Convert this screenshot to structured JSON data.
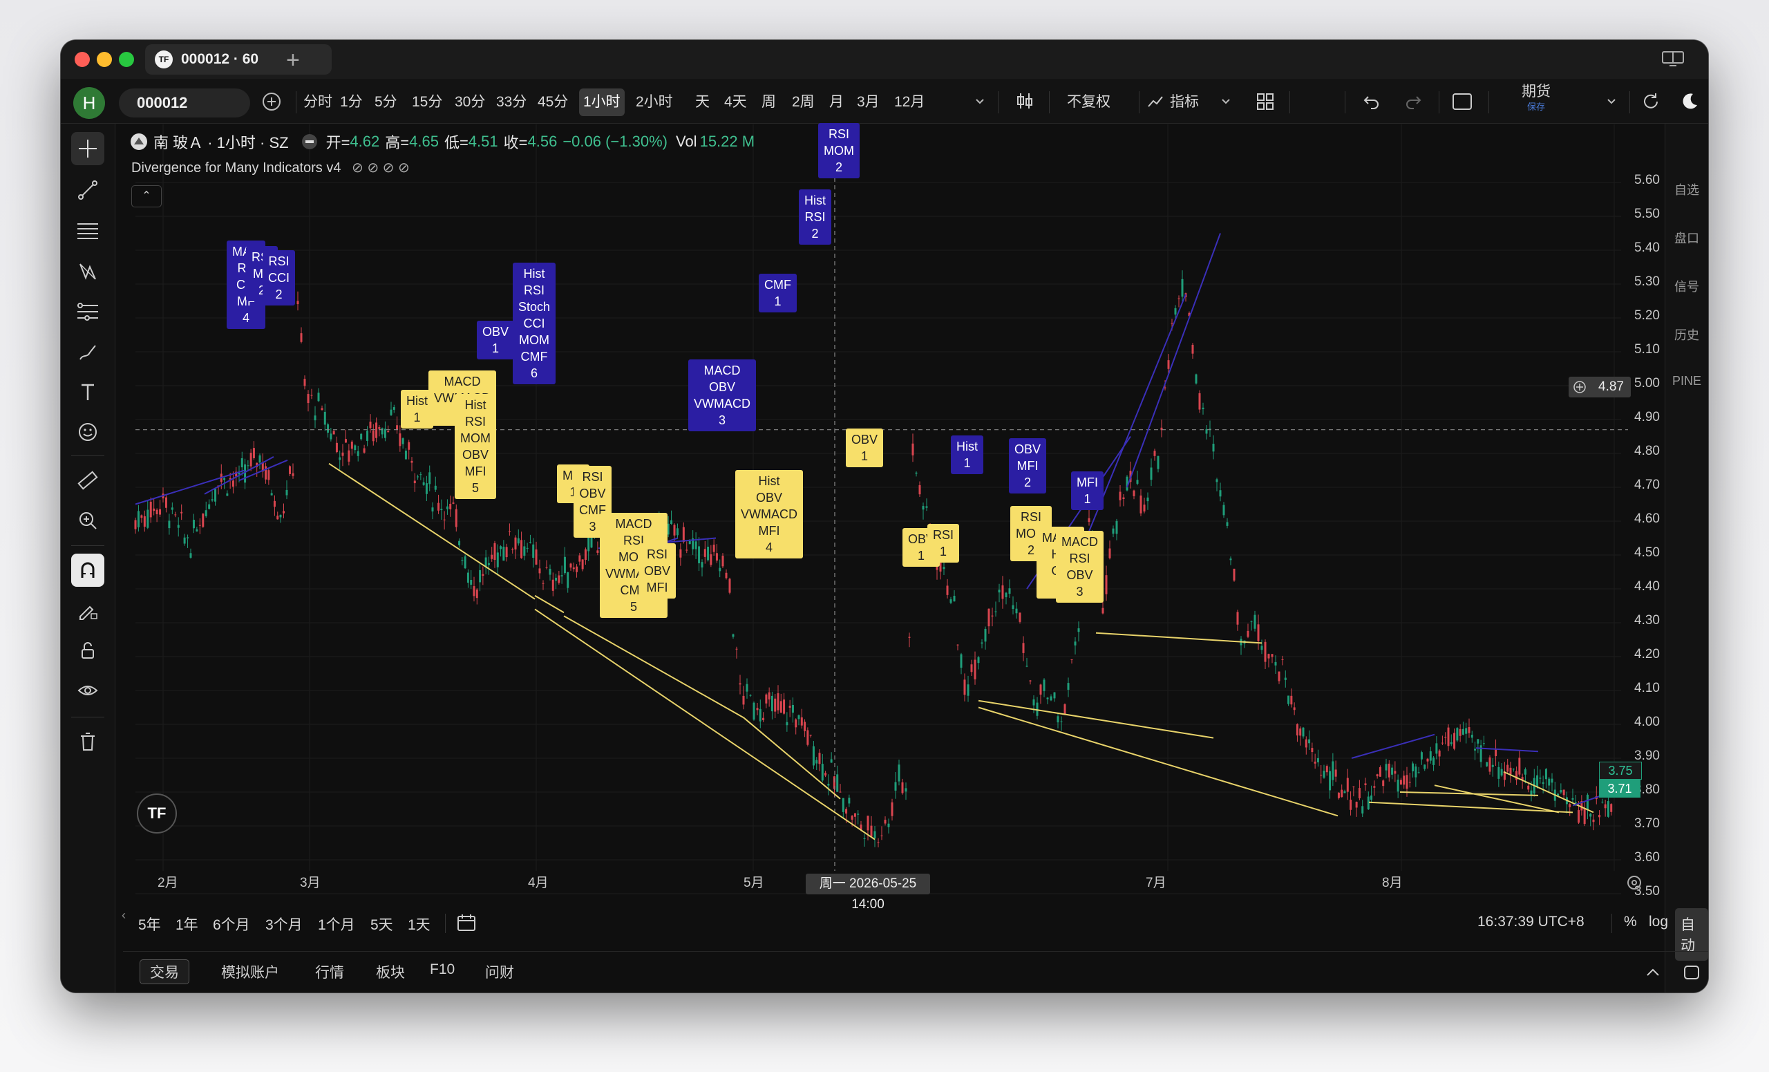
{
  "window": {
    "tab_title": "000012 · 60",
    "tab_logo": "TF"
  },
  "toolbar": {
    "avatar_letter": "H",
    "symbol": "000012",
    "timeframes": [
      "分时",
      "1分",
      "5分",
      "15分",
      "30分",
      "33分",
      "45分",
      "1小时",
      "2小时",
      "天",
      "4天",
      "周",
      "2周",
      "月",
      "3月",
      "12月"
    ],
    "active_timeframe": "1小时",
    "adjust_label": "不复权",
    "indicators_label": "指标",
    "futures_label": "期货",
    "futures_sub": "保存"
  },
  "legend": {
    "symbol_name": "南 玻Ａ · 1小时 · SZ",
    "open_label": "开=",
    "open": "4.62",
    "high_label": "高=",
    "high": "4.65",
    "low_label": "低=",
    "low": "4.51",
    "close_label": "收=",
    "close": "4.56",
    "change": "−0.06 (−1.30%)",
    "vol_label": "Vol",
    "vol": "15.22 M",
    "indicator_title": "Divergence for Many Indicators v4",
    "indicator_icons": "⊘ ⊘ ⊘ ⊘"
  },
  "price_axis": [
    "5.60",
    "5.50",
    "5.40",
    "5.30",
    "5.20",
    "5.10",
    "5.00",
    "4.90",
    "4.80",
    "4.70",
    "4.60",
    "4.50",
    "4.40",
    "4.30",
    "4.20",
    "4.10",
    "4.00",
    "3.90",
    "3.80",
    "3.70",
    "3.60",
    "3.50"
  ],
  "crosshair": {
    "price": "4.87",
    "time": "周一 2026-05-25   14:00"
  },
  "last_price": {
    "prev": "3.75",
    "current": "3.71"
  },
  "time_axis": [
    "2月",
    "3月",
    "4月",
    "5月",
    "7月",
    "8月"
  ],
  "ranges": [
    "5年",
    "1年",
    "6个月",
    "3个月",
    "1个月",
    "5天",
    "1天"
  ],
  "status": {
    "clock": "16:37:39 UTC+8",
    "percent": "%",
    "log": "log",
    "auto": "自动"
  },
  "bottom_tabs": [
    "交易",
    "模拟账户",
    "行情",
    "板块",
    "F10",
    "问财"
  ],
  "right_sidebar": [
    "自选",
    "盘口",
    "信号",
    "历史",
    "PINE"
  ],
  "labels": [
    {
      "t": "MAC\nRS\nCM\nMF\n4",
      "k": "bear"
    },
    {
      "t": "RSI\nMF\n2",
      "k": "bear"
    },
    {
      "t": "RSI\nCCI\n2",
      "k": "bear"
    },
    {
      "t": "Hist\nRSI\nStoch\nCCI\nMOM\nCMF\n6",
      "k": "bear"
    },
    {
      "t": "OBV\n1",
      "k": "bear"
    },
    {
      "t": "Hist\n1",
      "k": "bull"
    },
    {
      "t": "MACD\nVWMACD\n2",
      "k": "bull"
    },
    {
      "t": "Hist\nRSI\nMOM\nOBV\nMFI\n5",
      "k": "bull"
    },
    {
      "t": "MFI\n1",
      "k": "bull"
    },
    {
      "t": "RSI\nOBV\nCMF\n3",
      "k": "bull"
    },
    {
      "t": "MACD\nRSI\nMOM\nVWMACD\nCMF\n5",
      "k": "bull"
    },
    {
      "t": "RSI\nOBV\nMFI",
      "k": "bull"
    },
    {
      "t": "MACD\nOBV\nVWMACD\n3",
      "k": "bear"
    },
    {
      "t": "Hist\nOBV\nVWMACD\nMFI\n4",
      "k": "bull"
    },
    {
      "t": "CMF\n1",
      "k": "bear"
    },
    {
      "t": "Hist\nRSI\n2",
      "k": "bear"
    },
    {
      "t": "RSI\nMOM\n2",
      "k": "bear"
    },
    {
      "t": "OBV\n1",
      "k": "bull"
    },
    {
      "t": "OBV\n1",
      "k": "bull"
    },
    {
      "t": "RSI\n1",
      "k": "bull"
    },
    {
      "t": "Hist\n1",
      "k": "bear"
    },
    {
      "t": "OBV\nMFI\n2",
      "k": "bear"
    },
    {
      "t": "RSI\nMOM\n2",
      "k": "bull"
    },
    {
      "t": "MACD\nHis\nOB\n3",
      "k": "bull"
    },
    {
      "t": "MACD\nRSI\nOBV\n3",
      "k": "bull"
    },
    {
      "t": "MFI\n1",
      "k": "bear"
    }
  ],
  "colors": {
    "up": "#1f9e7a",
    "down": "#d9454f",
    "bull_label": "#f7df6a",
    "bear_label": "#2b1ea3",
    "bull_line": "#e8d36a",
    "bear_line": "#3a2fb8"
  }
}
